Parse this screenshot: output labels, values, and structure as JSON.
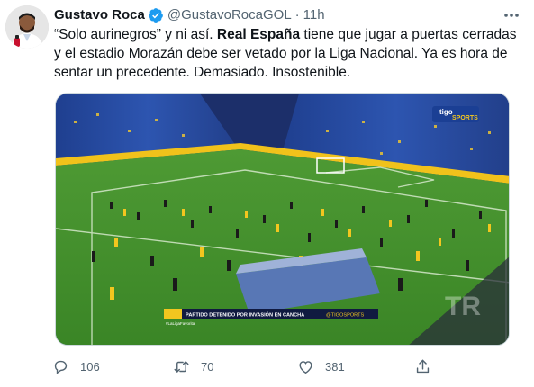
{
  "tweet": {
    "author": {
      "name": "Gustavo Roca",
      "handle": "@GustavoRocaGOL",
      "separator": "·",
      "time": "11h"
    },
    "text": {
      "part1": "“Solo aurinegros” y ni así. ",
      "bold": "Real España",
      "part2": " tiene que jugar a puertas cerradas y el estadio Morazán debe ser vetado por la Liga Nacional. Ya es hora de sentar un precedente. Demasiado. Insostenible."
    },
    "media": {
      "logo_top": "tigo",
      "logo_bottom": "SPORTS",
      "banner_text": "PARTIDO DETENIDO POR INVASIÓN EN CANCHA",
      "banner_handle": "@TIGOSPORTS",
      "banner_hashtag": "#LaLigaFavorita",
      "watermark": "TR"
    },
    "actions": {
      "reply_count": "106",
      "retweet_count": "70",
      "like_count": "381"
    },
    "colors": {
      "verified": "#1d9bf0",
      "muted": "#536471",
      "pitch": "#3f8f2a",
      "stands_blue": "#2b4fa8"
    }
  }
}
